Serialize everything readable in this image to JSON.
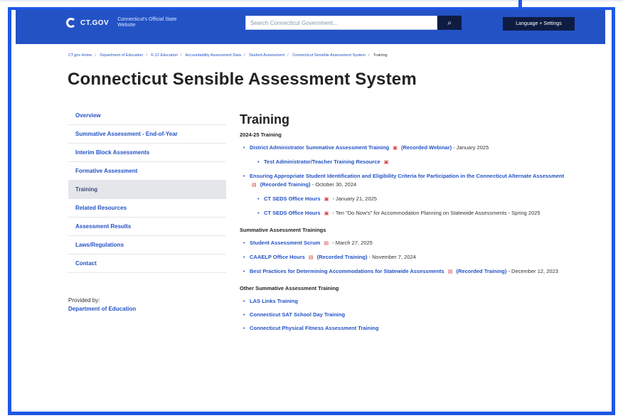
{
  "header": {
    "logo_text": "CT.GOV",
    "logo_sub": "Connecticut's Official State Website",
    "search_placeholder": "Search Connecticut Government...",
    "search_icon": "search-icon",
    "language_label": "Language + Settings"
  },
  "breadcrumb": [
    "CT.gov Home",
    "Department of Education",
    "K-12 Education",
    "Accountability Assessment Data",
    "Student Assessment",
    "Connecticut Sensible Assessment System",
    "Training"
  ],
  "page": {
    "title": "Connecticut Sensible Assessment System"
  },
  "sidebar": {
    "items": [
      "Overview",
      "Summative Assessment - End-of-Year",
      "Interim Block Assessments",
      "Formative Assessment",
      "Training",
      "Related Resources",
      "Assessment Results",
      "Laws/Regulations",
      "Contact"
    ],
    "active_index": 4,
    "provided_label": "Provided by:",
    "provided_link": "Department of Education"
  },
  "content": {
    "heading": "Training",
    "sections": [
      {
        "title": "2024-25 Training",
        "items": [
          {
            "level": 1,
            "link": "District Administrator Summative Assessment Training",
            "extra_link": "(Recorded Webinar)",
            "suffix": " - January 2025"
          },
          {
            "level": 2,
            "link": "Test Administrator/Teacher Training Resource",
            "extra_link": "",
            "suffix": ""
          },
          {
            "level": 1,
            "link": "Ensuring Appropriate Student Identification and Eligibility Criteria for Participation in the Connecticut Alternate Assessment",
            "extra_link": "(Recorded Training)",
            "suffix": " - October 30, 2024"
          },
          {
            "level": 2,
            "link": "CT SEDS Office Hours",
            "extra_link": "",
            "suffix": " - January 21, 2025"
          },
          {
            "level": 2,
            "link": "CT SEDS Office Hours",
            "extra_link": "",
            "suffix": " - Ten \"Do Now's\" for Accommodation Planning on Statewide Assessments - Spring 2025"
          }
        ]
      },
      {
        "title": "Summative Assessment Trainings",
        "items": [
          {
            "level": 1,
            "link": "Student Assessment Scrum",
            "extra_link": "",
            "suffix": " - March 27, 2025"
          },
          {
            "level": 1,
            "link": "CAAELP Office Hours",
            "extra_link": "(Recorded Training)",
            "suffix": " - November 7, 2024"
          },
          {
            "level": 1,
            "link": "Best Practices for Determining Accommodations for Statewide Assessments",
            "extra_link": "(Recorded Training)",
            "suffix": " - December 12, 2023"
          }
        ]
      },
      {
        "title": "Other Summative Assessment Training",
        "items": [
          {
            "level": 1,
            "link": "LAS Links Training",
            "extra_link": "",
            "suffix": ""
          },
          {
            "level": 1,
            "link": "Connecticut SAT School Day Training",
            "extra_link": "",
            "suffix": ""
          },
          {
            "level": 1,
            "link": "Connecticut Physical Fitness Assessment Training",
            "extra_link": "",
            "suffix": ""
          }
        ]
      }
    ]
  },
  "colors": {
    "frame": "#1f58e6",
    "header": "#2352c5",
    "link": "#2352c5",
    "dark_button": "#0f1c42"
  }
}
